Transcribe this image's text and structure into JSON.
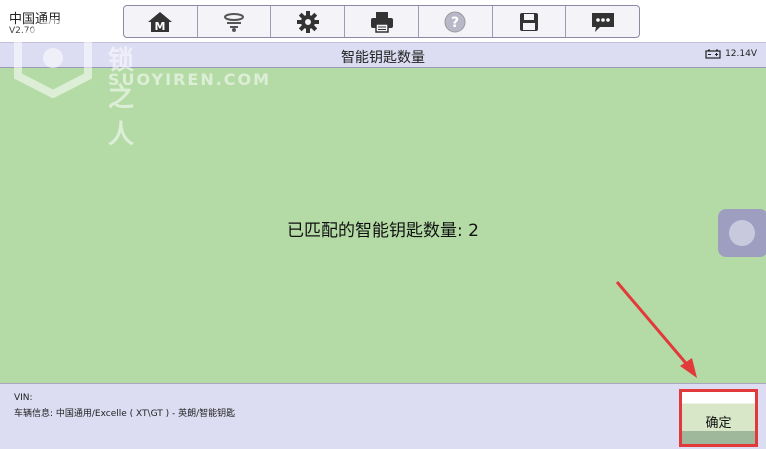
{
  "app": {
    "title": "中国通用",
    "version": "V2.70"
  },
  "toolbar": {
    "buttons": [
      {
        "icon": "home-icon"
      },
      {
        "icon": "vehicle-swap-icon"
      },
      {
        "icon": "gear-icon"
      },
      {
        "icon": "printer-icon"
      },
      {
        "icon": "help-icon"
      },
      {
        "icon": "save-icon"
      },
      {
        "icon": "message-icon"
      }
    ]
  },
  "title_bar": {
    "title": "智能钥匙数量",
    "battery_voltage": "12.14V"
  },
  "content": {
    "message": "已匹配的智能钥匙数量: 2"
  },
  "watermark": {
    "cn": "锁之人",
    "en": "SUOYIREN.COM"
  },
  "footer": {
    "vin_label": "VIN:",
    "vehicle_info": "车辆信息: 中国通用/Excelle ( XT\\GT ) - 英朗/智能钥匙",
    "ok_label": "确定"
  },
  "colors": {
    "content_bg": "#b4dba6",
    "chrome_bg": "#dcdcf2",
    "annotation": "#e23a3a"
  }
}
